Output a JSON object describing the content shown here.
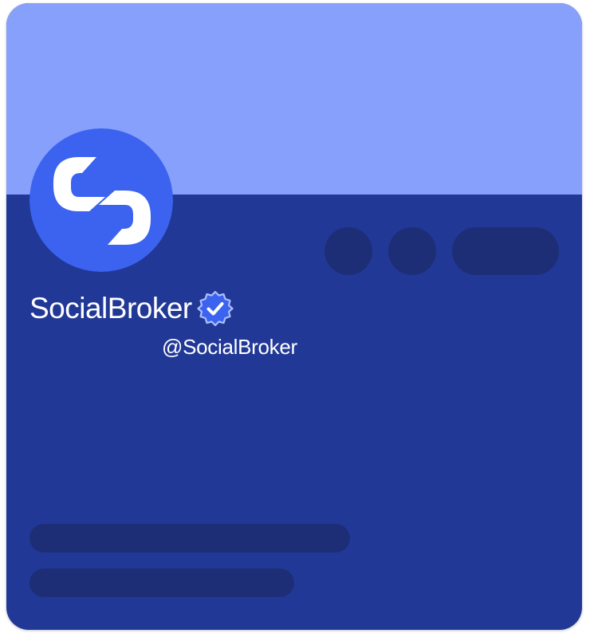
{
  "profile": {
    "display_name": "SocialBroker",
    "handle": "@SocialBroker",
    "verified": true
  },
  "icons": {
    "avatar": "socialbroker-logo-icon",
    "badge": "verified-check-icon"
  },
  "colors": {
    "banner": "#86a0fb",
    "card_body": "#213896",
    "avatar_bg": "#3b63f0",
    "placeholder": "#1d2e77",
    "badge": "#3b63f0",
    "text": "#ffffff"
  }
}
